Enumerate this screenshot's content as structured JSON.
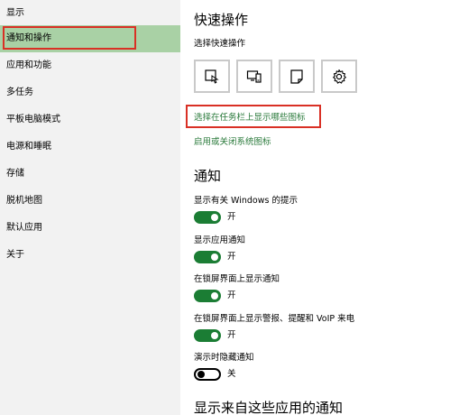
{
  "sidebar": {
    "items": [
      {
        "label": "显示"
      },
      {
        "label": "通知和操作"
      },
      {
        "label": "应用和功能"
      },
      {
        "label": "多任务"
      },
      {
        "label": "平板电脑模式"
      },
      {
        "label": "电源和睡眠"
      },
      {
        "label": "存储"
      },
      {
        "label": "脱机地图"
      },
      {
        "label": "默认应用"
      },
      {
        "label": "关于"
      }
    ],
    "selected_color": "#a9d1a5"
  },
  "quick_actions": {
    "title": "快速操作",
    "subtitle": "选择快速操作",
    "tiles": [
      {
        "icon": "tablet-mode-icon"
      },
      {
        "icon": "connect-icon"
      },
      {
        "icon": "note-icon"
      },
      {
        "icon": "settings-icon"
      }
    ],
    "link_taskbar": "选择在任务栏上显示哪些图标",
    "link_system_icons": "启用或关闭系统图标"
  },
  "notifications": {
    "title": "通知",
    "items": [
      {
        "label": "显示有关 Windows 的提示",
        "state": "开",
        "on": true
      },
      {
        "label": "显示应用通知",
        "state": "开",
        "on": true
      },
      {
        "label": "在锁屏界面上显示通知",
        "state": "开",
        "on": true
      },
      {
        "label": "在锁屏界面上显示警报、提醒和 VoIP 来电",
        "state": "开",
        "on": true
      },
      {
        "label": "演示时隐藏通知",
        "state": "关",
        "on": false
      }
    ]
  },
  "section_bottom": {
    "title": "显示来自这些应用的通知"
  },
  "colors": {
    "accent_toggle": "#1b7d34",
    "link": "#2a7a3b",
    "highlight_box": "#d93025"
  }
}
